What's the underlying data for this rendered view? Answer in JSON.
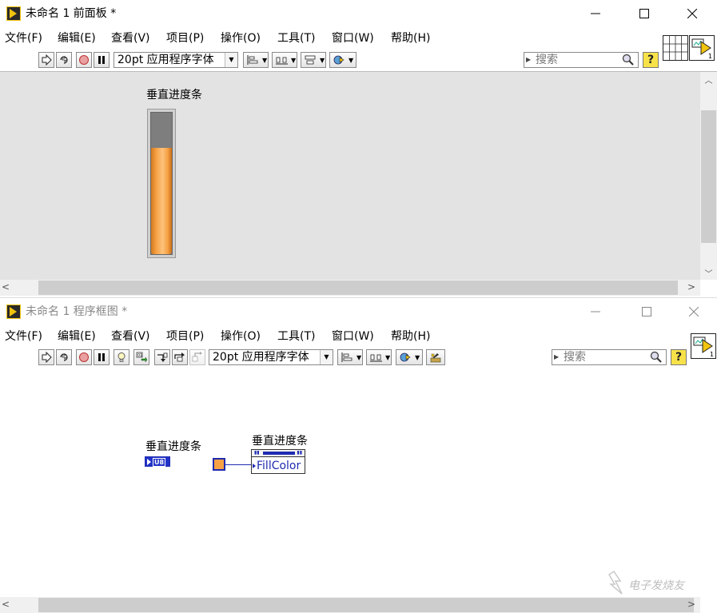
{
  "front_panel": {
    "title": "未命名 1 前面板 *",
    "menu": [
      "文件(F)",
      "编辑(E)",
      "查看(V)",
      "项目(P)",
      "操作(O)",
      "工具(T)",
      "窗口(W)",
      "帮助(H)"
    ],
    "toolbar": {
      "font": "20pt 应用程序字体",
      "search_placeholder": "搜索",
      "help": "?"
    },
    "control": {
      "label": "垂直进度条",
      "fill_fraction": 0.75,
      "fill_color": "#f6a144"
    }
  },
  "block_diagram": {
    "title": "未命名 1 程序框图 *",
    "menu": [
      "文件(F)",
      "编辑(E)",
      "查看(V)",
      "项目(P)",
      "操作(O)",
      "工具(T)",
      "窗口(W)",
      "帮助(H)"
    ],
    "toolbar": {
      "font": "20pt 应用程序字体",
      "search_placeholder": "搜索",
      "help": "?"
    },
    "terminal": {
      "label": "垂直进度条",
      "type": "U8"
    },
    "property_node": {
      "label": "垂直进度条",
      "property": "FillColor"
    },
    "color_constant": "#f6a144"
  },
  "vi_icon_number": "1",
  "watermark": "电子发烧友"
}
